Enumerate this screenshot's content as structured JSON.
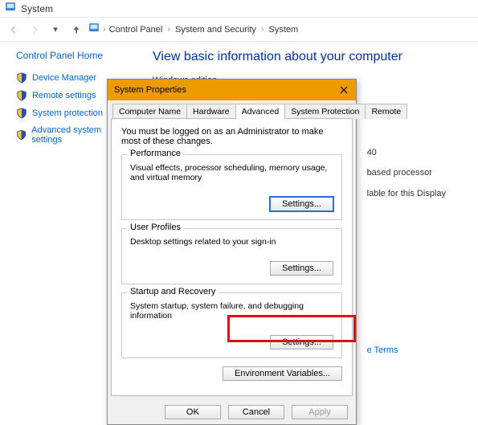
{
  "window": {
    "title": "System"
  },
  "breadcrumb": {
    "items": [
      "Control Panel",
      "System and Security",
      "System"
    ]
  },
  "sidebar": {
    "title": "Control Panel Home",
    "items": [
      {
        "label": "Device Manager"
      },
      {
        "label": "Remote settings"
      },
      {
        "label": "System protection"
      },
      {
        "label": "Advanced system settings"
      }
    ]
  },
  "content": {
    "heading": "View basic information about your computer",
    "section_label": "Windows edition"
  },
  "right_info": {
    "line1": "40",
    "line2": "based processor",
    "line3": "lable for this Display",
    "link": "e Terms"
  },
  "dialog": {
    "title": "System Properties",
    "tabs": [
      "Computer Name",
      "Hardware",
      "Advanced",
      "System Protection",
      "Remote"
    ],
    "active_tab": 2,
    "intro": "You must be logged on as an Administrator to make most of these changes.",
    "groups": [
      {
        "title": "Performance",
        "desc": "Visual effects, processor scheduling, memory usage, and virtual memory",
        "button": "Settings...",
        "focused": true
      },
      {
        "title": "User Profiles",
        "desc": "Desktop settings related to your sign-in",
        "button": "Settings..."
      },
      {
        "title": "Startup and Recovery",
        "desc": "System startup, system failure, and debugging information",
        "button": "Settings..."
      }
    ],
    "env_button": "Environment Variables...",
    "buttons": {
      "ok": "OK",
      "cancel": "Cancel",
      "apply": "Apply"
    }
  }
}
